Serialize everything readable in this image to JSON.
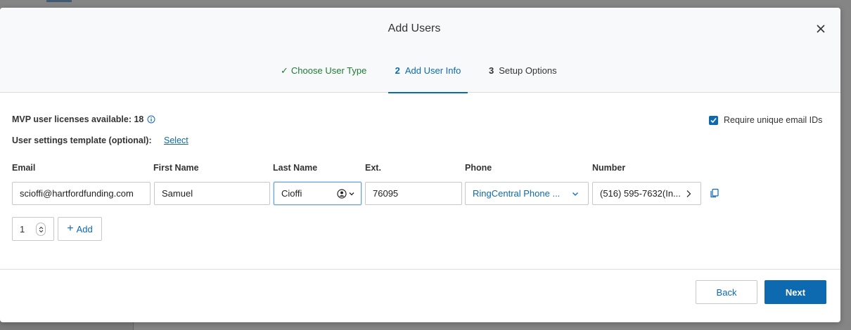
{
  "modal": {
    "title": "Add Users",
    "close_icon": "close-icon"
  },
  "steps": [
    {
      "number": "✓",
      "label": "Choose User Type",
      "state": "complete"
    },
    {
      "number": "2",
      "label": "Add User Info",
      "state": "active"
    },
    {
      "number": "3",
      "label": "Setup Options",
      "state": "upcoming"
    }
  ],
  "licenses": {
    "label": "MVP user licenses available: 18",
    "icon": "info-icon"
  },
  "template": {
    "label": "User settings template (optional):",
    "link": "Select"
  },
  "require_unique": {
    "label": "Require unique email IDs",
    "checked": true
  },
  "columns": {
    "email": "Email",
    "first_name": "First Name",
    "last_name": "Last Name",
    "ext": "Ext.",
    "phone": "Phone",
    "number": "Number"
  },
  "row": {
    "email": "scioffi@hartfordfunding.com",
    "first_name": "Samuel",
    "last_name": "Cioffi",
    "ext": "76095",
    "phone": "RingCentral Phone ...",
    "number": "(516) 595-7632(In..."
  },
  "add_row": {
    "count": "1",
    "add_label": "Add"
  },
  "footer": {
    "back_label": "Back",
    "next_label": "Next"
  },
  "colors": {
    "primary": "#0d69b0",
    "success": "#1f7a35"
  }
}
